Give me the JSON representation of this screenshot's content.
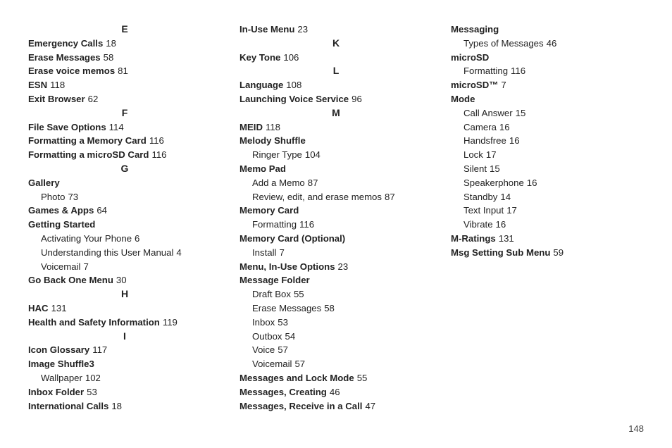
{
  "page_number": "148",
  "content": [
    {
      "kind": "letter",
      "text": "E"
    },
    {
      "kind": "entry",
      "term": "Emergency Calls",
      "page": "18"
    },
    {
      "kind": "entry",
      "term": "Erase Messages",
      "page": "58"
    },
    {
      "kind": "entry",
      "term": "Erase voice memos",
      "page": "81"
    },
    {
      "kind": "entry",
      "term": "ESN",
      "page": "118"
    },
    {
      "kind": "entry",
      "term": "Exit Browser",
      "page": "62"
    },
    {
      "kind": "letter",
      "text": "F"
    },
    {
      "kind": "entry",
      "term": "File Save Options",
      "page": "114"
    },
    {
      "kind": "entry",
      "term": "Formatting a Memory Card",
      "page": "116"
    },
    {
      "kind": "entry",
      "term": "Formatting a microSD Card",
      "page": "116"
    },
    {
      "kind": "letter",
      "text": "G"
    },
    {
      "kind": "entry",
      "term": "Gallery",
      "page": "",
      "subs": [
        {
          "text": "Photo",
          "page": "73"
        }
      ]
    },
    {
      "kind": "entry",
      "term": "Games & Apps",
      "page": "64"
    },
    {
      "kind": "entry",
      "term": "Getting Started",
      "page": "",
      "subs": [
        {
          "text": "Activating Your Phone",
          "page": "6"
        },
        {
          "text": "Understanding this User Manual",
          "page": "4"
        },
        {
          "text": "Voicemail",
          "page": "7"
        }
      ]
    },
    {
      "kind": "entry",
      "term": "Go Back One Menu",
      "page": "30"
    },
    {
      "kind": "letter",
      "text": "H"
    },
    {
      "kind": "entry",
      "term": "HAC",
      "page": "131"
    },
    {
      "kind": "entry",
      "term": "Health and Safety Information",
      "page": "119"
    },
    {
      "kind": "letter",
      "text": "I"
    },
    {
      "kind": "entry",
      "term": "Icon Glossary",
      "page": "117"
    },
    {
      "kind": "entry",
      "term": "Image Shuffle3",
      "page": "",
      "subs": [
        {
          "text": "Wallpaper",
          "page": "102"
        }
      ]
    },
    {
      "kind": "entry",
      "term": "Inbox Folder",
      "page": "53"
    },
    {
      "kind": "entry",
      "term": "International Calls",
      "page": "18"
    },
    {
      "kind": "entry",
      "term": "In-Use Menu",
      "page": "23"
    },
    {
      "kind": "letter",
      "text": "K"
    },
    {
      "kind": "entry",
      "term": "Key Tone",
      "page": "106"
    },
    {
      "kind": "letter",
      "text": "L"
    },
    {
      "kind": "entry",
      "term": "Language",
      "page": "108"
    },
    {
      "kind": "entry",
      "term": "Launching Voice Service",
      "page": "96"
    },
    {
      "kind": "letter",
      "text": "M"
    },
    {
      "kind": "entry",
      "term": "MEID",
      "page": "118"
    },
    {
      "kind": "entry",
      "term": "Melody Shuffle",
      "page": "",
      "subs": [
        {
          "text": "Ringer Type",
          "page": "104"
        }
      ]
    },
    {
      "kind": "entry",
      "term": "Memo Pad",
      "page": "",
      "subs": [
        {
          "text": "Add a Memo",
          "page": "87"
        },
        {
          "text": "Review, edit, and erase memos",
          "page": "87"
        }
      ]
    },
    {
      "kind": "entry",
      "term": "Memory Card",
      "page": "",
      "subs": [
        {
          "text": "Formatting",
          "page": "116"
        }
      ]
    },
    {
      "kind": "entry",
      "term": "Memory Card (Optional)",
      "page": "",
      "subs": [
        {
          "text": "Install",
          "page": "7"
        }
      ]
    },
    {
      "kind": "entry",
      "term": "Menu, In-Use Options",
      "page": "23"
    },
    {
      "kind": "entry",
      "term": "Message Folder",
      "page": "",
      "subs": [
        {
          "text": "Draft Box",
          "page": "55"
        },
        {
          "text": "Erase Messages",
          "page": "58"
        },
        {
          "text": "Inbox",
          "page": "53"
        },
        {
          "text": "Outbox",
          "page": "54"
        },
        {
          "text": "Voice",
          "page": "57"
        },
        {
          "text": "Voicemail",
          "page": "57"
        }
      ]
    },
    {
      "kind": "entry",
      "term": "Messages and Lock Mode",
      "page": "55"
    },
    {
      "kind": "entry",
      "term": "Messages, Creating",
      "page": "46"
    },
    {
      "kind": "entry",
      "term": "Messages, Receive in a Call",
      "page": "47"
    },
    {
      "kind": "entry",
      "term": "Messaging",
      "page": "",
      "subs": [
        {
          "text": "Types of Messages",
          "page": "46"
        }
      ]
    },
    {
      "kind": "entry",
      "term": "microSD",
      "page": "",
      "subs": [
        {
          "text": "Formatting",
          "page": "116"
        }
      ]
    },
    {
      "kind": "entry",
      "term": "microSD™",
      "page": "7"
    },
    {
      "kind": "entry",
      "term": "Mode",
      "page": "",
      "subs": [
        {
          "text": "Call Answer",
          "page": "15"
        },
        {
          "text": "Camera",
          "page": "16"
        },
        {
          "text": "Handsfree",
          "page": "16"
        },
        {
          "text": "Lock",
          "page": "17"
        },
        {
          "text": "Silent",
          "page": "15"
        },
        {
          "text": "Speakerphone",
          "page": "16"
        },
        {
          "text": "Standby",
          "page": "14"
        },
        {
          "text": "Text Input",
          "page": "17"
        },
        {
          "text": "Vibrate",
          "page": "16"
        }
      ]
    },
    {
      "kind": "entry",
      "term": "M-Ratings",
      "page": "131"
    },
    {
      "kind": "entry",
      "term": "Msg Setting Sub Menu",
      "page": "59"
    }
  ]
}
